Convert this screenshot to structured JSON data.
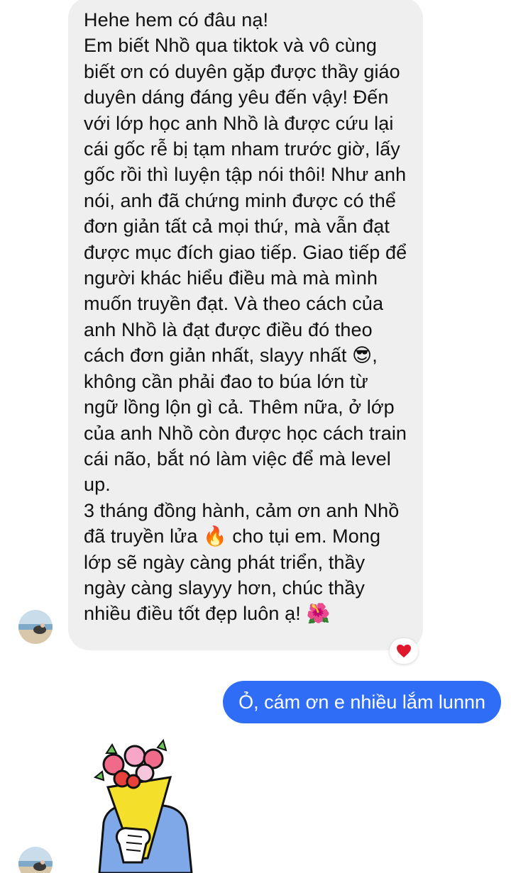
{
  "conversation": {
    "incoming_message": {
      "text": "Hehe hem có đâu nạ!\nEm biết Nhồ qua tiktok và vô cùng biết ơn có duyên gặp được thầy giáo duyên dáng đáng yêu đến vậy! Đến với lớp học anh Nhồ là được cứu lại cái gốc rễ bị tạm nham trước giờ, lấy gốc rồi thì luyện tập nói thôi! Như anh nói, anh đã chứng minh được có thể đơn giản tất cả mọi thứ, mà vẫn đạt được mục đích giao tiếp. Giao tiếp để người khác hiểu điều mà mà mình muốn truyền đạt. Và theo cách của anh Nhồ là đạt được điều đó theo cách đơn giản nhất, slayy nhất 😎, không cần phải đao to búa lớn từ ngữ lồng lộn gì cả. Thêm nữa, ở lớp của anh Nhồ còn được học cách train cái não, bắt nó làm việc để mà level up.\n3 tháng đồng hành, cảm ơn anh Nhồ đã truyền lửa 🔥 cho tụi em. Mong lớp sẽ ngày càng phát triển, thầy ngày càng slayyy hơn, chúc thầy nhiều điều tốt đẹp luôn ạ! 🌺",
      "reaction": "❤️"
    },
    "outgoing_message": {
      "text": "Ỏ, cám ơn e nhiều lắm lunnn"
    },
    "sticker": {
      "description_icon": "flower-bouquet-sticker"
    }
  },
  "colors": {
    "incoming_bubble": "#efefef",
    "outgoing_bubble": "#2f6df6",
    "reaction_heart": "#e0182d"
  }
}
